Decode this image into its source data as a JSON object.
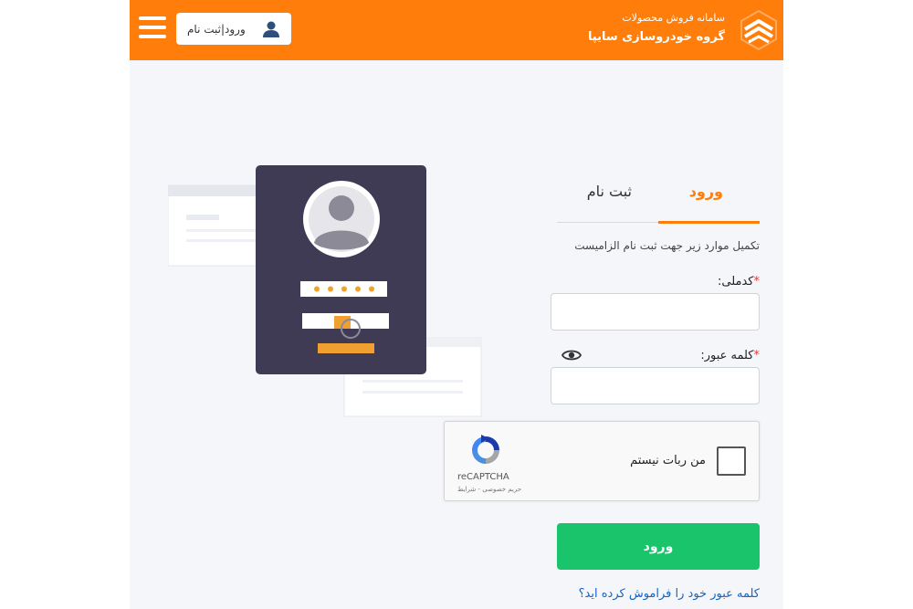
{
  "header": {
    "nav_sub": "سامانه   فروش   محصولات",
    "brand_title": "گروه خودروسازی سایپا",
    "login_register_label": "ورود|ثبت نام"
  },
  "tabs": [
    {
      "label": "ورود",
      "active": true
    },
    {
      "label": "ثبت نام",
      "active": false
    }
  ],
  "form": {
    "hint": "تکمیل موارد زیر جهت ثبت نام الزامیست",
    "required_mark": "*",
    "national_code_label": "کدملی:",
    "national_code_value": "",
    "password_label": "کلمه عبور:",
    "password_value": "",
    "submit_label": "ورود",
    "forgot_link": "کلمه عبور خود را فراموش کرده اید؟"
  },
  "captcha": {
    "checkbox_label": "من ربات نیستم",
    "brand": "reCAPTCHA",
    "terms": "حریم خصوصی - شرایط"
  },
  "colors": {
    "accent": "#ff7d0a",
    "submit": "#19c46b",
    "link": "#1565c0",
    "card": "#3f3b54"
  },
  "icons": [
    "saipa-logo",
    "user-icon",
    "menu-icon",
    "eye-icon",
    "recaptcha-logo"
  ]
}
